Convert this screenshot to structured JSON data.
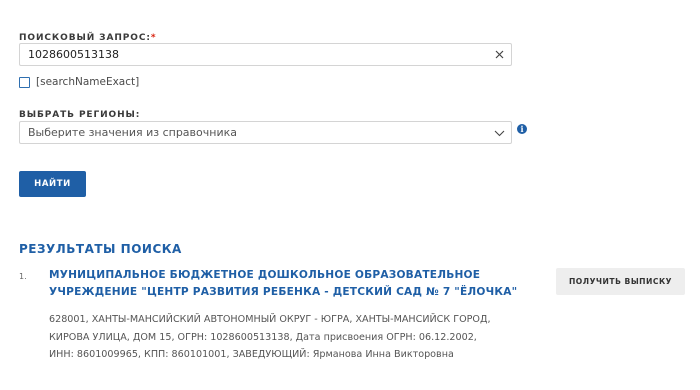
{
  "search": {
    "label": "ПОИСКОВЫЙ ЗАПРОС:",
    "required_mark": "*",
    "value": "1028600513138",
    "exact_label": "[searchNameExact]",
    "exact_checked": false
  },
  "regions": {
    "label": "ВЫБРАТЬ РЕГИОНЫ:",
    "placeholder": "Выберите значения из справочника",
    "info_glyph": "i"
  },
  "find_button": "НАЙТИ",
  "results": {
    "heading": "РЕЗУЛЬТАТЫ ПОИСКА",
    "items": [
      {
        "number": "1.",
        "title": "МУНИЦИПАЛЬНОЕ БЮДЖЕТНОЕ ДОШКОЛЬНОЕ ОБРАЗОВАТЕЛЬНОЕ УЧРЕЖДЕНИЕ \"ЦЕНТР РАЗВИТИЯ РЕБЕНКА - ДЕТСКИЙ САД № 7 \"ЁЛОЧКА\"",
        "description": "628001, ХАНТЫ-МАНСИЙСКИЙ АВТОНОМНЫЙ ОКРУГ - ЮГРА, ХАНТЫ-МАНСИЙСК ГОРОД, КИРОВА УЛИЦА, ДОМ 15, ОГРН: 1028600513138, Дата присвоения ОГРН: 06.12.2002, ИНН: 8601009965, КПП: 860101001, ЗАВЕДУЮЩИЙ: Ярманова Инна Викторовна",
        "action": "ПОЛУЧИТЬ ВЫПИСКУ"
      }
    ]
  },
  "colors": {
    "accent": "#1f5fa6",
    "required": "#d9230f",
    "button_secondary": "#eeeeee"
  }
}
